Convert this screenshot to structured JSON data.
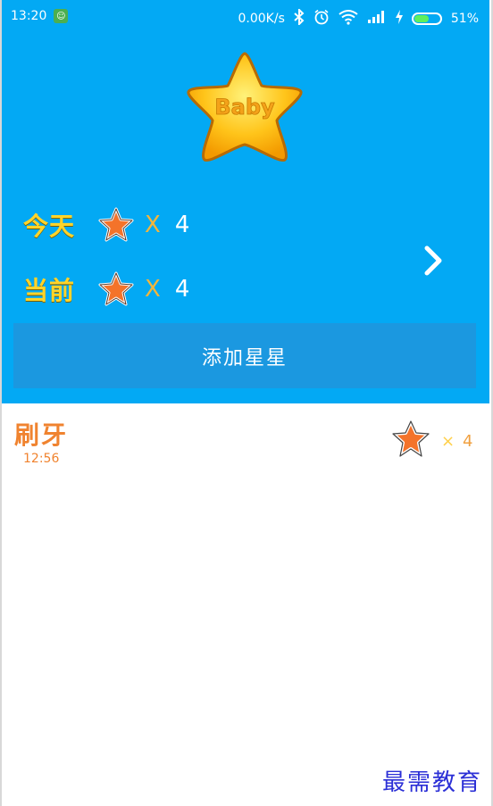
{
  "status_bar": {
    "time": "13:20",
    "network_speed": "0.00K/s",
    "battery": "51%"
  },
  "header": {
    "badge_text": "Baby",
    "rows": [
      {
        "label": "今天",
        "times": "X",
        "count": "4"
      },
      {
        "label": "当前",
        "times": "X",
        "count": "4"
      }
    ],
    "add_button": "添加星星"
  },
  "records": [
    {
      "title": "刷牙",
      "time": "12:56",
      "times": "×",
      "count": "4"
    }
  ],
  "watermark": "最需教育",
  "colors": {
    "header_bg": "#03a9f4",
    "button_bg": "#1b98e0",
    "label_yellow": "#ffd42a",
    "orange": "#f0832f"
  }
}
